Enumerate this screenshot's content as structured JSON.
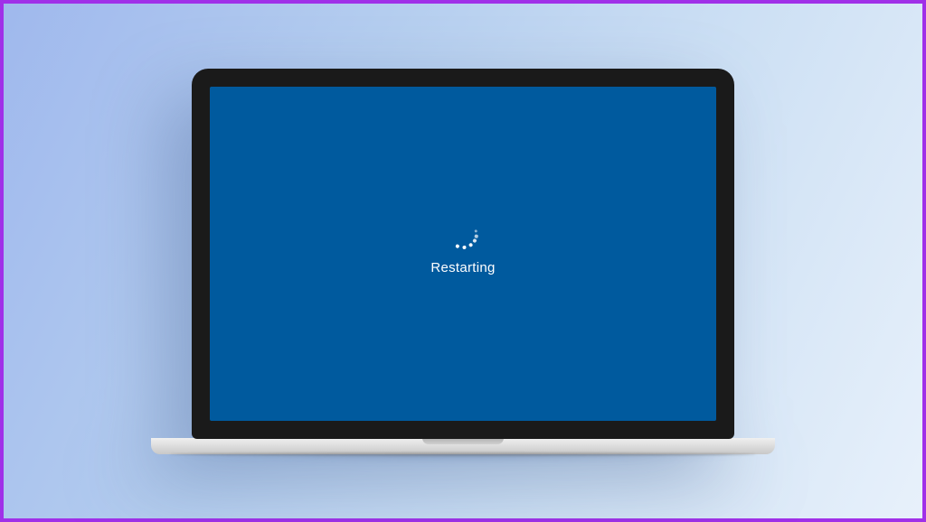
{
  "screen": {
    "status_message": "Restarting",
    "background_color": "#005a9e",
    "text_color": "#ffffff"
  }
}
